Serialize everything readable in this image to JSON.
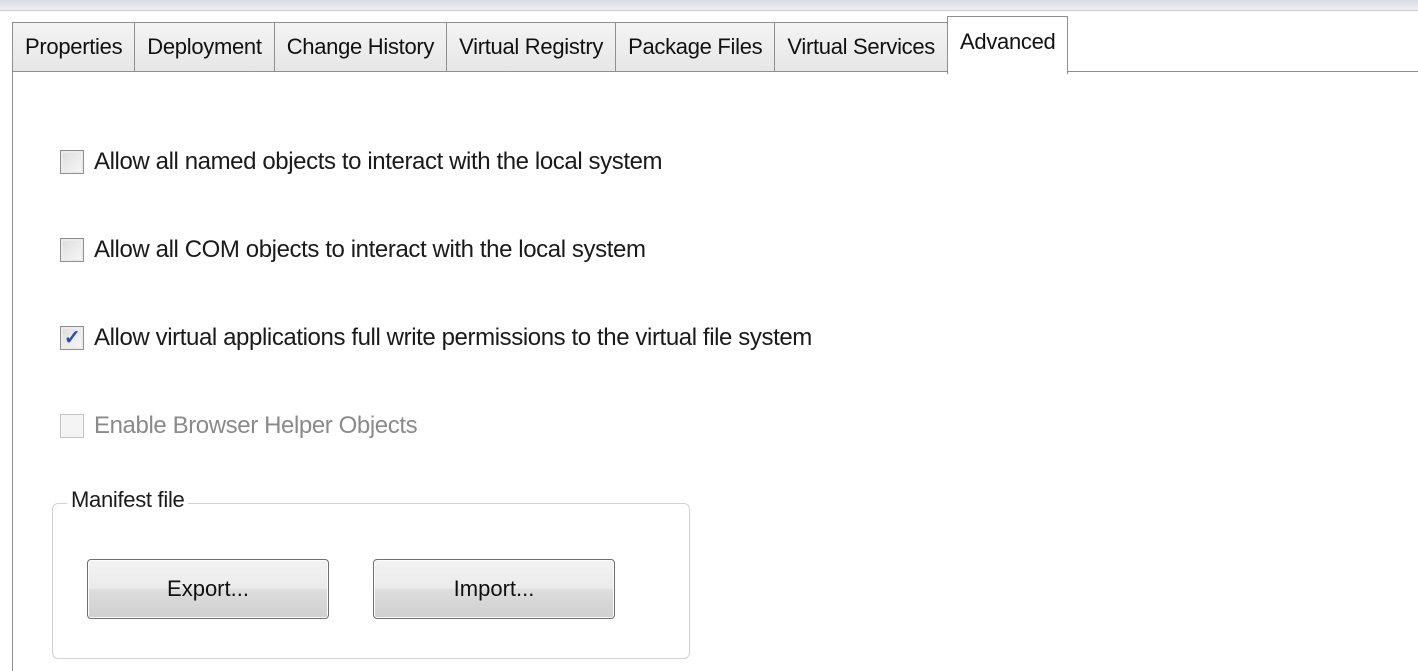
{
  "tabs": [
    {
      "label": "Properties",
      "active": false
    },
    {
      "label": "Deployment",
      "active": false
    },
    {
      "label": "Change History",
      "active": false
    },
    {
      "label": "Virtual Registry",
      "active": false
    },
    {
      "label": "Package Files",
      "active": false
    },
    {
      "label": "Virtual Services",
      "active": false
    },
    {
      "label": "Advanced",
      "active": true
    }
  ],
  "options": [
    {
      "label": "Allow all named objects to interact with the local system",
      "checked": false,
      "enabled": true
    },
    {
      "label": "Allow all COM objects to interact with the local system",
      "checked": false,
      "enabled": true
    },
    {
      "label": "Allow virtual applications full write permissions to the virtual file system",
      "checked": true,
      "enabled": true
    },
    {
      "label": "Enable Browser Helper Objects",
      "checked": false,
      "enabled": false
    }
  ],
  "manifest": {
    "title": "Manifest file",
    "export_label": "Export...",
    "import_label": "Import..."
  },
  "colors": {
    "check_mark": "#2b4fa8",
    "disabled_text": "#8a8a8a"
  }
}
